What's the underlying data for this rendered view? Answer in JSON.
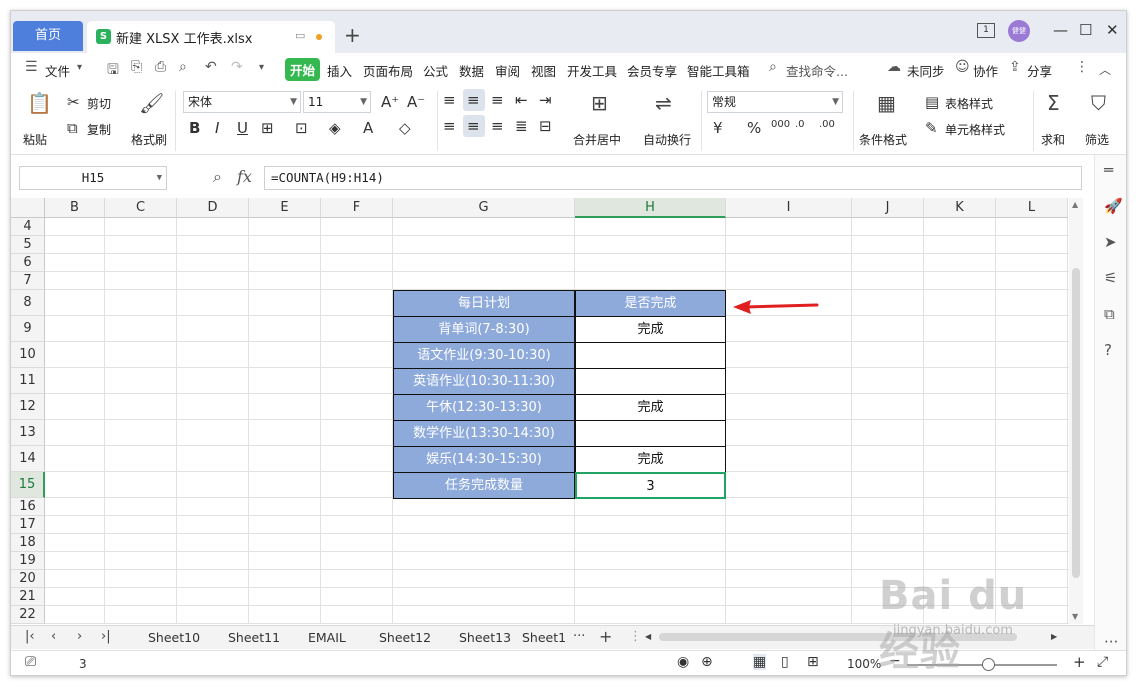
{
  "titlebar": {
    "home_tab": "首页",
    "file_tab": "新建 XLSX 工作表.xlsx",
    "file_icon_letter": "S",
    "new_tab": "+",
    "box_indicator": "1",
    "avatar_text": "健健"
  },
  "menubar": {
    "file": "文件",
    "items": [
      "开始",
      "插入",
      "页面布局",
      "公式",
      "数据",
      "审阅",
      "视图",
      "开发工具",
      "会员专享",
      "智能工具箱"
    ],
    "search": "查找命令...",
    "sync": "未同步",
    "collab": "协作",
    "share": "分享"
  },
  "ribbon": {
    "paste": "粘贴",
    "cut": "剪切",
    "copy": "复制",
    "format_painter": "格式刷",
    "font_name": "宋体",
    "font_size": "11",
    "merge_center": "合并居中",
    "auto_wrap": "自动换行",
    "number_format": "常规",
    "conditional_format": "条件格式",
    "table_style": "表格样式",
    "cell_style": "单元格样式",
    "sum": "求和",
    "filter": "筛选"
  },
  "formula_bar": {
    "name_box": "H15",
    "fx": "fx",
    "formula": "=COUNTA(H9:H14)"
  },
  "grid": {
    "columns": [
      "B",
      "C",
      "D",
      "E",
      "F",
      "G",
      "H",
      "I",
      "J",
      "K",
      "L"
    ],
    "selected_column": "H",
    "selected_row": "15",
    "rows": [
      "4",
      "5",
      "6",
      "7",
      "8",
      "9",
      "10",
      "11",
      "12",
      "13",
      "14",
      "15",
      "16",
      "17",
      "18",
      "19",
      "20",
      "21",
      "22"
    ],
    "table": {
      "header_g": "每日计划",
      "header_h": "是否完成",
      "rows": [
        {
          "plan": "背单词(7-8:30)",
          "done": "完成"
        },
        {
          "plan": "语文作业(9:30-10:30)",
          "done": ""
        },
        {
          "plan": "英语作业(10:30-11:30)",
          "done": ""
        },
        {
          "plan": "午休(12:30-13:30)",
          "done": "完成"
        },
        {
          "plan": "数学作业(13:30-14:30)",
          "done": ""
        },
        {
          "plan": "娱乐(14:30-15:30)",
          "done": "完成"
        }
      ],
      "summary_label": "任务完成数量",
      "summary_value": "3"
    },
    "arrow_color": "#e02020"
  },
  "sheets": {
    "tabs": [
      "Sheet10",
      "Sheet11",
      "EMAIL",
      "Sheet12",
      "Sheet13",
      "Sheet1"
    ],
    "more": "···",
    "add": "+"
  },
  "statusbar": {
    "value": "3",
    "zoom": "100%",
    "zoom_level": 0.54
  },
  "watermark": {
    "main": "Bai du 经验",
    "sub": "jingyan.baidu.com"
  },
  "colors": {
    "accent_green": "#34b84f",
    "home_tab_blue": "#4f7fdc",
    "table_header_fill": "#8eaadb",
    "active_cell_border": "#21a366"
  }
}
